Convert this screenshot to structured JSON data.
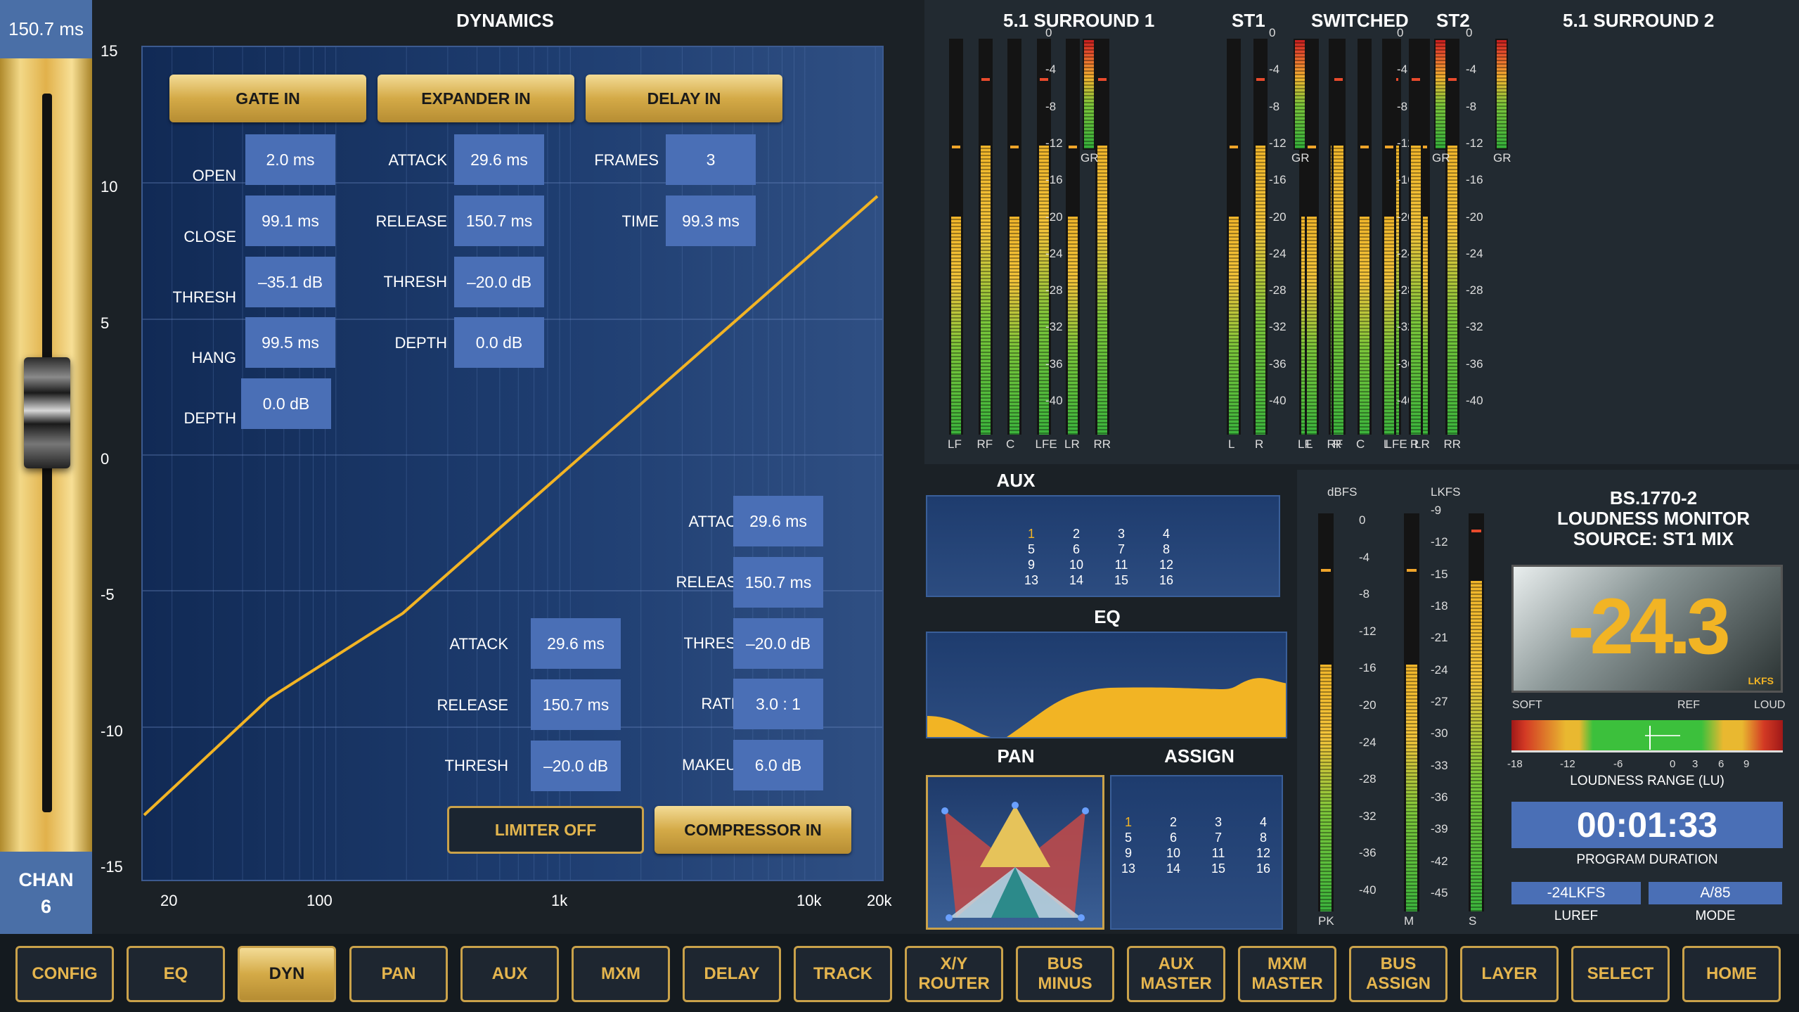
{
  "fader": {
    "value": "150.7 ms",
    "chan_label": "CHAN",
    "chan_num": "6"
  },
  "dynamics": {
    "title": "DYNAMICS",
    "y_ticks": [
      "15",
      "10",
      "5",
      "0",
      "-5",
      "-10",
      "-15"
    ],
    "x_ticks": [
      "20",
      "100",
      "1k",
      "10k",
      "20k"
    ],
    "buttons": {
      "gate": "GATE IN",
      "expander": "EXPANDER IN",
      "delay": "DELAY IN",
      "limiter": "LIMITER OFF",
      "compressor": "COMPRESSOR IN"
    },
    "gate": {
      "open_label": "OPEN",
      "open": "2.0 ms",
      "close_label": "CLOSE",
      "close": "99.1 ms",
      "thresh_label": "THRESH",
      "thresh": "–35.1 dB",
      "hang_label": "HANG",
      "hang": "99.5 ms",
      "depth_label": "DEPTH",
      "depth": "0.0 dB"
    },
    "expander": {
      "attack_label": "ATTACK",
      "attack": "29.6 ms",
      "release_label": "RELEASE",
      "release": "150.7 ms",
      "thresh_label": "THRESH",
      "thresh": "–20.0 dB",
      "depth_label": "DEPTH",
      "depth": "0.0 dB"
    },
    "delay": {
      "frames_label": "FRAMES",
      "frames": "3",
      "time_label": "TIME",
      "time": "99.3 ms"
    },
    "limiter": {
      "attack_label": "ATTACK",
      "attack": "29.6 ms",
      "release_label": "RELEASE",
      "release": "150.7 ms",
      "thresh_label": "THRESH",
      "thresh": "–20.0 dB"
    },
    "compressor": {
      "attack_label": "ATTACK",
      "attack": "29.6 ms",
      "release_label": "RELEASE",
      "release": "150.7 ms",
      "thresh_label": "THRESH",
      "thresh": "–20.0 dB",
      "ratio_label": "RATIO",
      "ratio": "3.0 : 1",
      "makeup_label": "MAKEUP",
      "makeup": "6.0 dB"
    }
  },
  "meters": {
    "groups": [
      "5.1 SURROUND 1",
      "ST1",
      "SWITCHED",
      "ST2",
      "5.1 SURROUND 2"
    ],
    "scale": [
      "0",
      "-4",
      "-8",
      "-12",
      "-16",
      "-20",
      "-24",
      "-28",
      "-32",
      "-36",
      "-40"
    ],
    "gr": "GR",
    "surround_channels": [
      "LF",
      "RF",
      "C",
      "LFE",
      "LR",
      "RR"
    ],
    "stereo_channels": [
      "L",
      "R"
    ]
  },
  "aux": {
    "title": "AUX",
    "numbers": [
      "1",
      "2",
      "3",
      "4",
      "5",
      "6",
      "7",
      "8",
      "9",
      "10",
      "11",
      "12",
      "13",
      "14",
      "15",
      "16"
    ]
  },
  "eq": {
    "title": "EQ"
  },
  "pan": {
    "title": "PAN"
  },
  "assign": {
    "title": "ASSIGN",
    "numbers": [
      "1",
      "2",
      "3",
      "4",
      "5",
      "6",
      "7",
      "8",
      "9",
      "10",
      "11",
      "12",
      "13",
      "14",
      "15",
      "16"
    ]
  },
  "loudness": {
    "dbfs_label": "dBFS",
    "lkfs_label": "LKFS",
    "dbfs_scale": [
      "0",
      "-4",
      "-8",
      "-12",
      "-16",
      "-20",
      "-24",
      "-28",
      "-32",
      "-36",
      "-40"
    ],
    "lkfs_scale": [
      "-9",
      "-12",
      "-15",
      "-18",
      "-21",
      "-24",
      "-27",
      "-30",
      "-33",
      "-36",
      "-39",
      "-42",
      "-45"
    ],
    "bar_labels": [
      "PK",
      "M",
      "S"
    ],
    "title_line1": "BS.1770-2",
    "title_line2": "LOUDNESS MONITOR",
    "title_line3": "SOURCE: ST1 MIX",
    "big_value": "-24.3",
    "big_unit": "LKFS",
    "range_soft": "SOFT",
    "range_ref": "REF",
    "range_loud": "LOUD",
    "range_ticks": [
      "-18",
      "-12",
      "-6",
      "0",
      "3",
      "6",
      "9"
    ],
    "range_label": "LOUDNESS RANGE (LU)",
    "duration": "00:01:33",
    "duration_label": "PROGRAM DURATION",
    "luref": "-24LKFS",
    "luref_label": "LUREF",
    "mode": "A/85",
    "mode_label": "MODE"
  },
  "nav": [
    "CONFIG",
    "EQ",
    "DYN",
    "PAN",
    "AUX",
    "MXM",
    "DELAY",
    "TRACK",
    "X/Y ROUTER",
    "BUS MINUS",
    "AUX MASTER",
    "MXM MASTER",
    "BUS ASSIGN",
    "LAYER",
    "SELECT",
    "HOME"
  ],
  "nav_active": "DYN"
}
